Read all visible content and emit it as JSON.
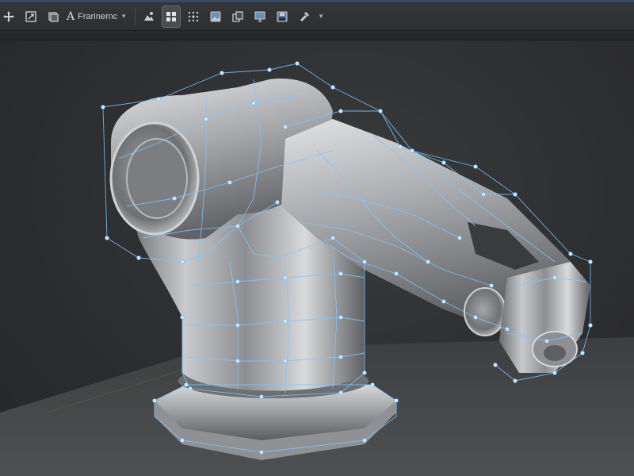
{
  "toolbar": {
    "frame_mode_label": "Frarinernc",
    "tools": [
      "move-tool",
      "scale-tool",
      "layers-tool",
      "frame-mode-dropdown",
      "material-tool",
      "grid-view-tool",
      "snap-points-tool",
      "image-tool",
      "copy-tool",
      "display-tool",
      "save-tool",
      "paint-tool"
    ]
  },
  "viewport": {
    "object": "robotic-arm-model",
    "wireframe_color": "#7fc7ff",
    "background_color": "#2d2e30",
    "floor_color": "#4a4b4d"
  }
}
